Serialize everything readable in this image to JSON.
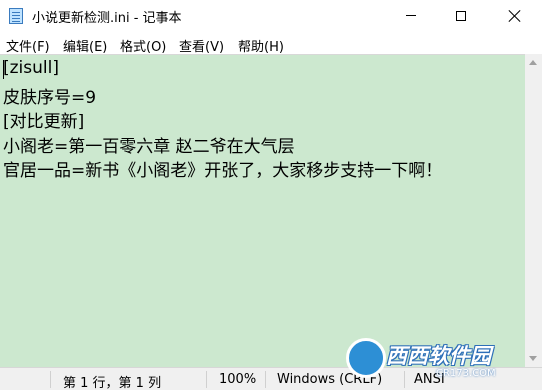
{
  "window": {
    "title": "小说更新检测.ini - 记事本"
  },
  "menu": {
    "file": "文件(F)",
    "edit": "编辑(E)",
    "format": "格式(O)",
    "view": "查看(V)",
    "help": "帮助(H)"
  },
  "editor": {
    "lines": [
      "[zisull]",
      "皮肤序号=9",
      "[对比更新]",
      "小阁老=第一百零六章 赵二爷在大气层",
      "官居一品=新书《小阁老》开张了，大家移步支持一下啊！"
    ],
    "background": "#cce8cf"
  },
  "status": {
    "position": "第 1 行，第 1 列",
    "zoom": "100%",
    "line_ending": "Windows (CRLF)",
    "encoding": "ANSI"
  },
  "watermark": {
    "brand": "西西软件园",
    "url": "CR173.COM"
  }
}
